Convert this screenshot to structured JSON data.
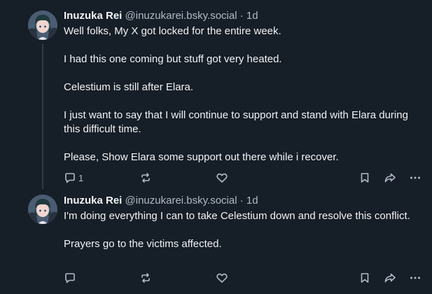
{
  "posts": [
    {
      "author": {
        "name": "Inuzuka Rei",
        "handle": "@inuzukarei.bsky.social",
        "separator": "·",
        "time": "1d"
      },
      "paragraphs": [
        "Well folks, My X got locked for the entire week.",
        "I had this one coming but stuff got very heated.",
        "Celestium is still after Elara.",
        "I just want to say that I will continue to support and stand with Elara during this difficult time.",
        "Please, Show Elara some support out there while i recover."
      ],
      "actions": {
        "reply_count": "1",
        "repost_count": "",
        "like_count": ""
      }
    },
    {
      "author": {
        "name": "Inuzuka Rei",
        "handle": "@inuzukarei.bsky.social",
        "separator": "·",
        "time": "1d"
      },
      "paragraphs": [
        "I'm doing everything I can to take Celestium down and resolve this conflict.",
        "Prayers go to the victims affected."
      ],
      "actions": {
        "reply_count": "",
        "repost_count": "",
        "like_count": ""
      }
    }
  ],
  "icons": {
    "reply": "reply-icon",
    "repost": "repost-icon",
    "like": "heart-icon",
    "bookmark": "bookmark-icon",
    "share": "share-icon",
    "more": "more-icon"
  },
  "colors": {
    "background": "#161e27",
    "text": "#f1f3f5",
    "muted": "#aebbc9",
    "thread_line": "#2e3b4a"
  }
}
